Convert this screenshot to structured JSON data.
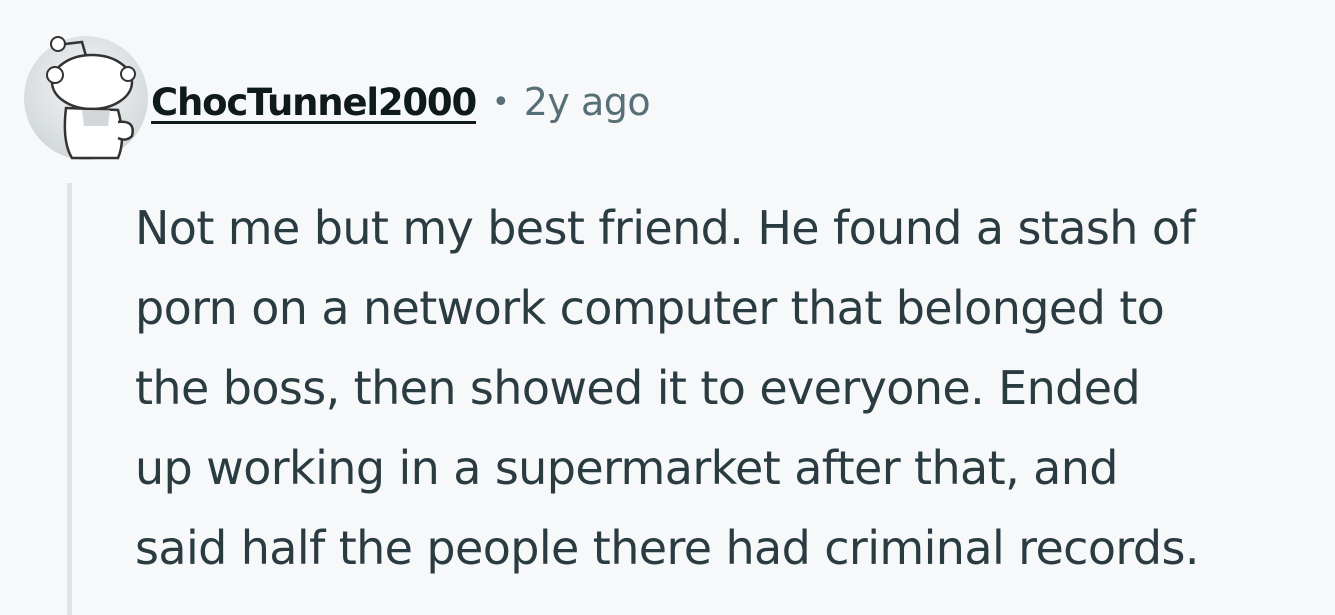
{
  "comment": {
    "author": "ChocTunnel2000",
    "separator": "•",
    "timestamp": "2y ago",
    "avatar_icon": "snoo-avatar-icon",
    "body_lines": [
      "Not me but my best friend. He found a stash of",
      "porn on a network computer that belonged to",
      "the boss, then showed it to everyone. Ended",
      "up working in a supermarket after that, and",
      "said half the people there had criminal records."
    ]
  },
  "colors": {
    "background": "#f7f8fa",
    "author": "#0f1a1c",
    "meta": "#576f76",
    "body_text": "#2a3c42",
    "thread_line": "#dde3e6"
  }
}
